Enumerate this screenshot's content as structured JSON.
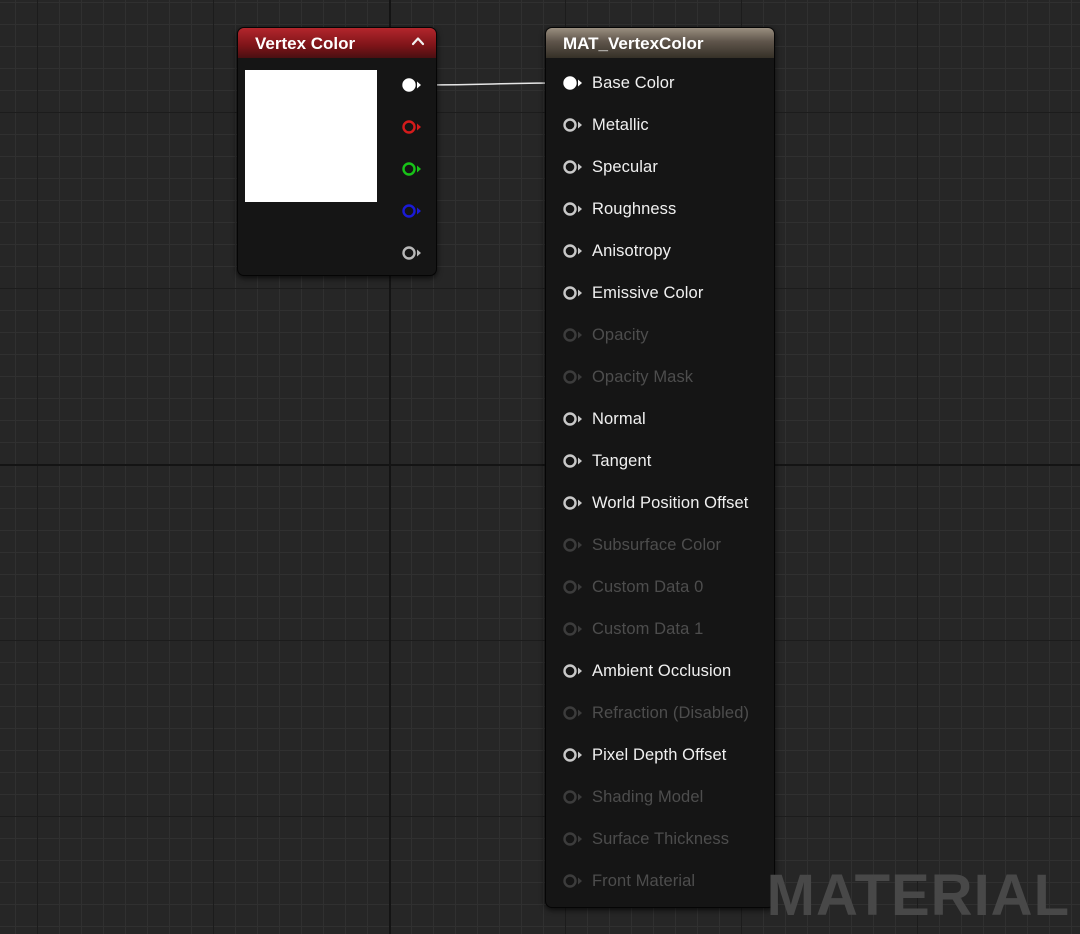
{
  "graph": {
    "watermark": "MATERIAL"
  },
  "vertex_color_node": {
    "title": "Vertex Color",
    "header_color": "#8e1a1f",
    "preview_color": "#ffffff",
    "collapse_icon": "chevron-up-icon",
    "outputs": [
      {
        "name": "rgb",
        "color": "#ffffff",
        "connected": true
      },
      {
        "name": "r",
        "color": "#d41b1b",
        "connected": false
      },
      {
        "name": "g",
        "color": "#18c318",
        "connected": false
      },
      {
        "name": "b",
        "color": "#1a1ad6",
        "connected": false
      },
      {
        "name": "a",
        "color": "#b8b8b8",
        "connected": false
      }
    ]
  },
  "material_node": {
    "title": "MAT_VertexColor",
    "header_color": "#6b6154",
    "inputs": [
      {
        "label": "Base Color",
        "enabled": true,
        "connected": true
      },
      {
        "label": "Metallic",
        "enabled": true,
        "connected": false
      },
      {
        "label": "Specular",
        "enabled": true,
        "connected": false
      },
      {
        "label": "Roughness",
        "enabled": true,
        "connected": false
      },
      {
        "label": "Anisotropy",
        "enabled": true,
        "connected": false
      },
      {
        "label": "Emissive Color",
        "enabled": true,
        "connected": false
      },
      {
        "label": "Opacity",
        "enabled": false,
        "connected": false
      },
      {
        "label": "Opacity Mask",
        "enabled": false,
        "connected": false
      },
      {
        "label": "Normal",
        "enabled": true,
        "connected": false
      },
      {
        "label": "Tangent",
        "enabled": true,
        "connected": false
      },
      {
        "label": "World Position Offset",
        "enabled": true,
        "connected": false
      },
      {
        "label": "Subsurface Color",
        "enabled": false,
        "connected": false
      },
      {
        "label": "Custom Data 0",
        "enabled": false,
        "connected": false
      },
      {
        "label": "Custom Data 1",
        "enabled": false,
        "connected": false
      },
      {
        "label": "Ambient Occlusion",
        "enabled": true,
        "connected": false
      },
      {
        "label": "Refraction (Disabled)",
        "enabled": false,
        "connected": false
      },
      {
        "label": "Pixel Depth Offset",
        "enabled": true,
        "connected": false
      },
      {
        "label": "Shading Model",
        "enabled": false,
        "connected": false
      },
      {
        "label": "Surface Thickness",
        "enabled": false,
        "connected": false
      },
      {
        "label": "Front Material",
        "enabled": false,
        "connected": false
      }
    ]
  },
  "connections": [
    {
      "from": "vertex_color_node.outputs.0",
      "to": "material_node.inputs.0"
    }
  ]
}
